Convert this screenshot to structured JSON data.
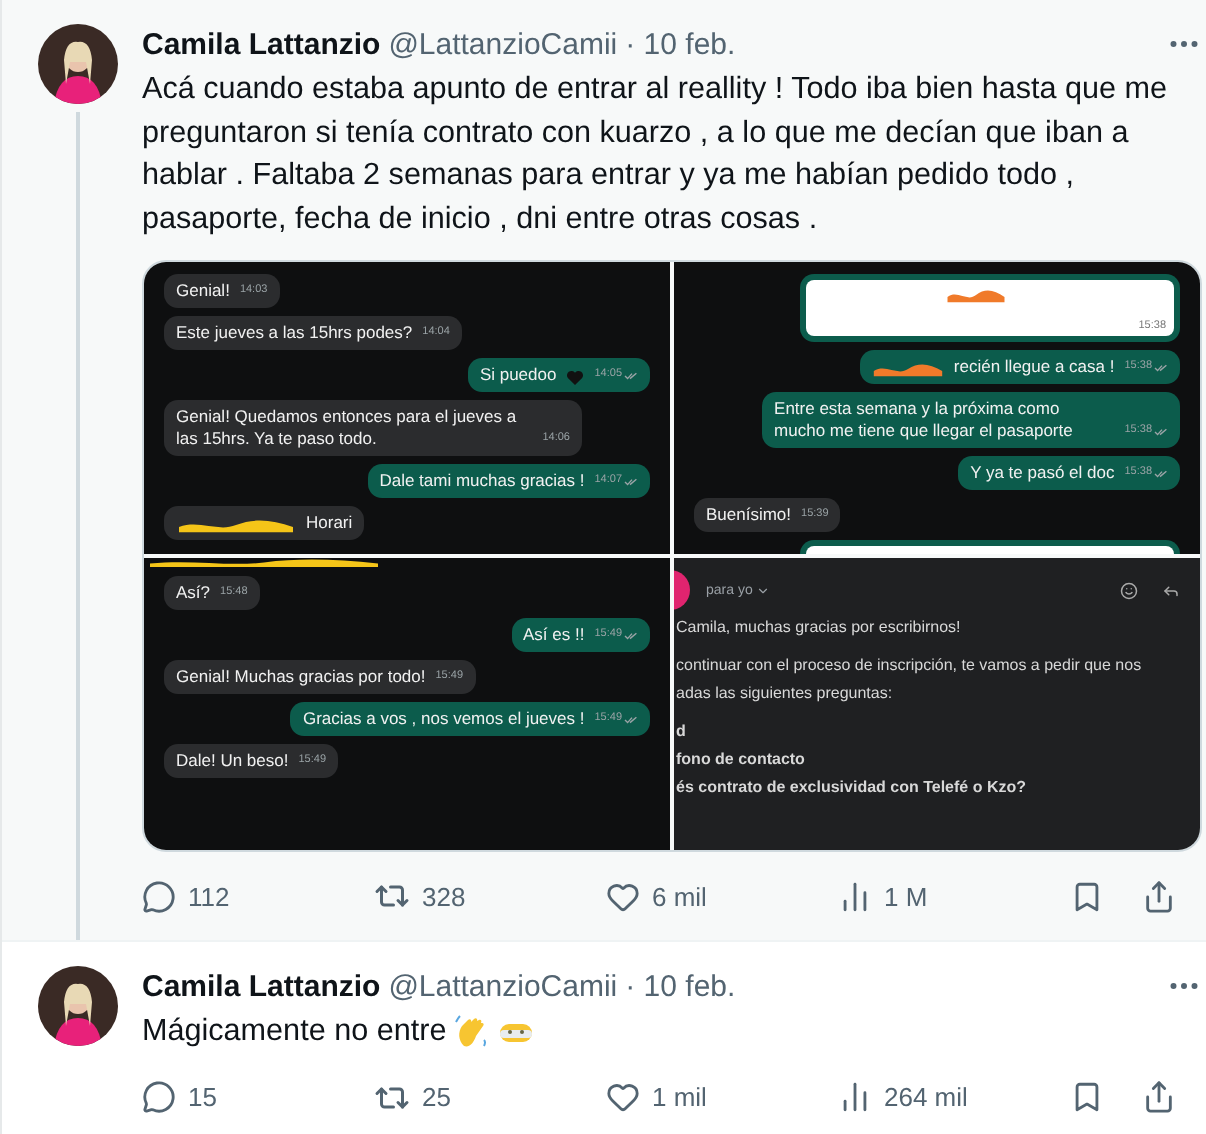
{
  "tweets": [
    {
      "author": "Camila Lattanzio",
      "handle": "@LattanzioCamii",
      "date": "· 10 feb.",
      "thread": true,
      "highlighted": true,
      "text": "Acá cuando estaba apunto de entrar al reallity ! Todo iba bien hasta que me preguntaron si tenía contrato con kuarzo , a lo que me decían que iban a hablar . Faltaba 2 semanas para entrar y ya me habían pedido todo , pasaporte, fecha de inicio , dni entre otras cosas .",
      "media": [
        {
          "kind": "chat",
          "messages": [
            {
              "kind": "in",
              "text": "Genial!",
              "time": "14:03"
            },
            {
              "kind": "in",
              "text": "Este jueves a las 15hrs podes?",
              "time": "14:04"
            },
            {
              "kind": "out",
              "text": "Si puedoo",
              "time": "14:05",
              "heart": true
            },
            {
              "kind": "in",
              "text": "Genial! Quedamos entonces para el jueves a las 15hrs. Ya te paso todo.",
              "time": "14:06"
            },
            {
              "kind": "out",
              "text": "Dale tami muchas gracias !",
              "time": "14:07"
            },
            {
              "kind": "in",
              "text": "Horari",
              "color": "#f5c518"
            }
          ]
        },
        {
          "kind": "chat",
          "messages": [
            {
              "kind": "image",
              "time": "15:38",
              "color": "#f07a2a"
            },
            {
              "kind": "out",
              "text": "recién llegue a casa !",
              "time": "15:38",
              "color": "#f07a2a"
            },
            {
              "kind": "out",
              "text": "Entre esta semana y la próxima como mucho me tiene que llegar el pasaporte",
              "time": "15:38"
            },
            {
              "kind": "out",
              "text": "Y ya te pasó el doc",
              "time": "15:38"
            },
            {
              "kind": "in",
              "text": "Buenísimo!",
              "time": "15:39"
            },
            {
              "kind": "image"
            }
          ]
        },
        {
          "kind": "chat",
          "top_mark": {
            "color": "#f5c518"
          },
          "messages": [
            {
              "kind": "in",
              "text": "Así?",
              "time": "15:48"
            },
            {
              "kind": "out",
              "text": "Así es !!",
              "time": "15:49"
            },
            {
              "kind": "in",
              "text": "Genial! Muchas gracias por todo!",
              "time": "15:49"
            },
            {
              "kind": "out",
              "text": "Gracias a vos , nos vemos el jueves !",
              "time": "15:49"
            },
            {
              "kind": "in",
              "text": "Dale! Un beso!",
              "time": "15:49"
            }
          ]
        },
        {
          "kind": "email",
          "recipient": "para yo",
          "lines": [
            {
              "text": "Camila, muchas gracias por escribirnos!",
              "bold": false
            },
            {
              "text": "continuar con el proceso de inscripción, te vamos a pedir que nos",
              "bold": false
            },
            {
              "text": "adas las siguientes preguntas:",
              "bold": false
            },
            {
              "text": "d",
              "bold": true
            },
            {
              "text": "fono de contacto",
              "bold": true
            },
            {
              "text": "és contrato de exclusividad con Telefé o Kzo?",
              "bold": true
            }
          ]
        }
      ],
      "stats": {
        "replies": "112",
        "retweets": "328",
        "likes": "6 mil",
        "views": "1 M"
      }
    },
    {
      "author": "Camila Lattanzio",
      "handle": "@LattanzioCamii",
      "date": "· 10 feb.",
      "thread": false,
      "highlighted": false,
      "text": "Mágicamente no entre",
      "emojis": [
        {
          "kind": "wave"
        },
        {
          "kind": "fog"
        }
      ],
      "stats": {
        "replies": "15",
        "retweets": "25",
        "likes": "1 mil",
        "views": "264 mil"
      }
    }
  ]
}
